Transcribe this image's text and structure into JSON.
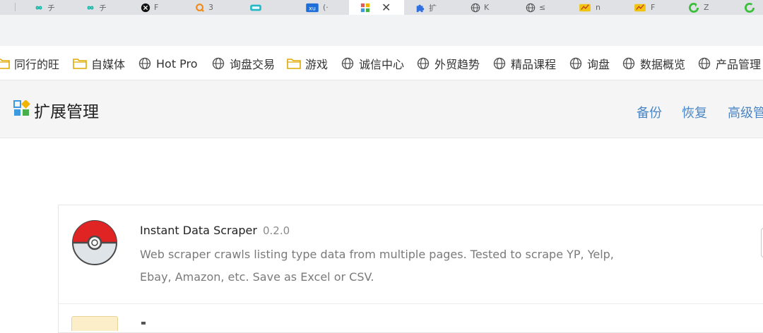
{
  "tabs": [
    {
      "name": "tab-1",
      "title": "",
      "icon": "partial-icon"
    },
    {
      "name": "tab-2",
      "title": "チ",
      "icon": "infinity-icon",
      "color": "#15b8a6"
    },
    {
      "name": "tab-3",
      "title": "チ",
      "icon": "infinity-icon",
      "color": "#15b8a6"
    },
    {
      "name": "tab-4",
      "title": "F",
      "icon": "dark-circle-icon"
    },
    {
      "name": "tab-5",
      "title": "3",
      "icon": "orange-q-icon",
      "color": "#f28a1a"
    },
    {
      "name": "tab-6",
      "title": "",
      "icon": "teal-logo-icon",
      "color": "#25b8c7"
    },
    {
      "name": "tab-7",
      "title": "(·",
      "icon": "blue-xu-icon",
      "color": "#1d6ed8"
    },
    {
      "name": "tab-8",
      "title": "",
      "icon": "extensions-grid-icon",
      "active": true
    },
    {
      "name": "tab-9",
      "title": "扩",
      "icon": "puzzle-icon",
      "color": "#2f6fe0"
    },
    {
      "name": "tab-10",
      "title": "K",
      "icon": "globe-icon"
    },
    {
      "name": "tab-11",
      "title": "≤",
      "icon": "globe-icon"
    },
    {
      "name": "tab-12",
      "title": "n",
      "icon": "yellow-folder-icon",
      "color": "#f1c40f"
    },
    {
      "name": "tab-13",
      "title": "F",
      "icon": "yellow-folder-icon",
      "color": "#f1c40f"
    },
    {
      "name": "tab-14",
      "title": "Z",
      "icon": "green-refresh-icon",
      "color": "#3bbf3b"
    },
    {
      "name": "tab-15",
      "title": "",
      "icon": "green-refresh-icon",
      "color": "#3bbf3b"
    }
  ],
  "bookmarks": [
    {
      "label": "同行的旺",
      "icon": "folder-icon"
    },
    {
      "label": "自媒体",
      "icon": "folder-icon"
    },
    {
      "label": "Hot Pro",
      "icon": "globe-icon"
    },
    {
      "label": "询盘交易",
      "icon": "globe-icon"
    },
    {
      "label": "游戏",
      "icon": "folder-icon"
    },
    {
      "label": "诚信中心",
      "icon": "globe-icon"
    },
    {
      "label": "外贸趋势",
      "icon": "globe-icon"
    },
    {
      "label": "精品课程",
      "icon": "globe-icon"
    },
    {
      "label": "询盘",
      "icon": "globe-icon"
    },
    {
      "label": "数据概览",
      "icon": "globe-icon"
    },
    {
      "label": "产品管理",
      "icon": "globe-icon"
    }
  ],
  "header": {
    "title": "扩展管理",
    "links": {
      "backup": "备份",
      "restore": "恢复",
      "advanced": "高级管"
    }
  },
  "extension": {
    "name": "Instant Data Scraper",
    "version": "0.2.0",
    "description": "Web scraper crawls listing type data from multiple pages. Tested to scrape YP, Yelp, Ebay, Amazon, etc. Save as Excel or CSV."
  },
  "colors": {
    "link": "#4a86c5",
    "folder": "#f3c847",
    "accent_red": "#e02424"
  }
}
